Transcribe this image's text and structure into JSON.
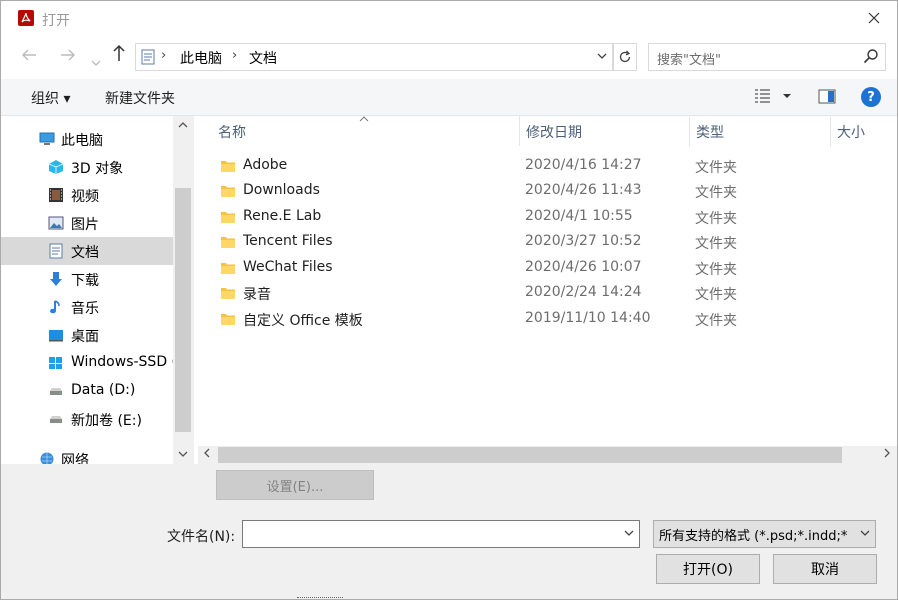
{
  "window": {
    "title": "打开"
  },
  "address": {
    "segments": [
      "此电脑",
      "文档"
    ]
  },
  "search": {
    "placeholder": "搜索\"文档\""
  },
  "toolbar": {
    "organize": "组织 ▾",
    "new_folder": "新建文件夹"
  },
  "nav": {
    "items": [
      {
        "label": "此电脑",
        "icon": "computer-icon"
      },
      {
        "label": "3D 对象",
        "icon": "3d-objects-icon"
      },
      {
        "label": "视频",
        "icon": "video-icon"
      },
      {
        "label": "图片",
        "icon": "pictures-icon"
      },
      {
        "label": "文档",
        "icon": "documents-icon"
      },
      {
        "label": "下载",
        "icon": "download-icon"
      },
      {
        "label": "音乐",
        "icon": "music-icon"
      },
      {
        "label": "桌面",
        "icon": "desktop-icon"
      },
      {
        "label": "Windows-SSD (",
        "icon": "windows-drive-icon"
      },
      {
        "label": "Data (D:)",
        "icon": "drive-icon"
      },
      {
        "label": "新加卷 (E:)",
        "icon": "drive-icon"
      },
      {
        "label": "网络",
        "icon": "network-icon"
      }
    ],
    "selected": "文档"
  },
  "columns": {
    "name": "名称",
    "modified": "修改日期",
    "type": "类型",
    "size": "大小"
  },
  "files": [
    {
      "name": "Adobe",
      "modified": "2020/4/16 14:27",
      "type": "文件夹"
    },
    {
      "name": "Downloads",
      "modified": "2020/4/26 11:43",
      "type": "文件夹"
    },
    {
      "name": "Rene.E Lab",
      "modified": "2020/4/1 10:55",
      "type": "文件夹"
    },
    {
      "name": "Tencent Files",
      "modified": "2020/3/27 10:52",
      "type": "文件夹"
    },
    {
      "name": "WeChat Files",
      "modified": "2020/4/26 10:07",
      "type": "文件夹"
    },
    {
      "name": "录音",
      "modified": "2020/2/24 14:24",
      "type": "文件夹"
    },
    {
      "name": "自定义 Office 模板",
      "modified": "2019/11/10 14:40",
      "type": "文件夹"
    }
  ],
  "settings_button": "设置(E)...",
  "filename": {
    "label": "文件名(N):",
    "value": ""
  },
  "filter": {
    "selected": "所有支持的格式 (*.psd;*.indd;*"
  },
  "buttons": {
    "open": "打开(O)",
    "cancel": "取消"
  },
  "colors": {
    "accent": "#1e73d2",
    "selection": "#d9d9d9",
    "folder": "#f5c342"
  }
}
